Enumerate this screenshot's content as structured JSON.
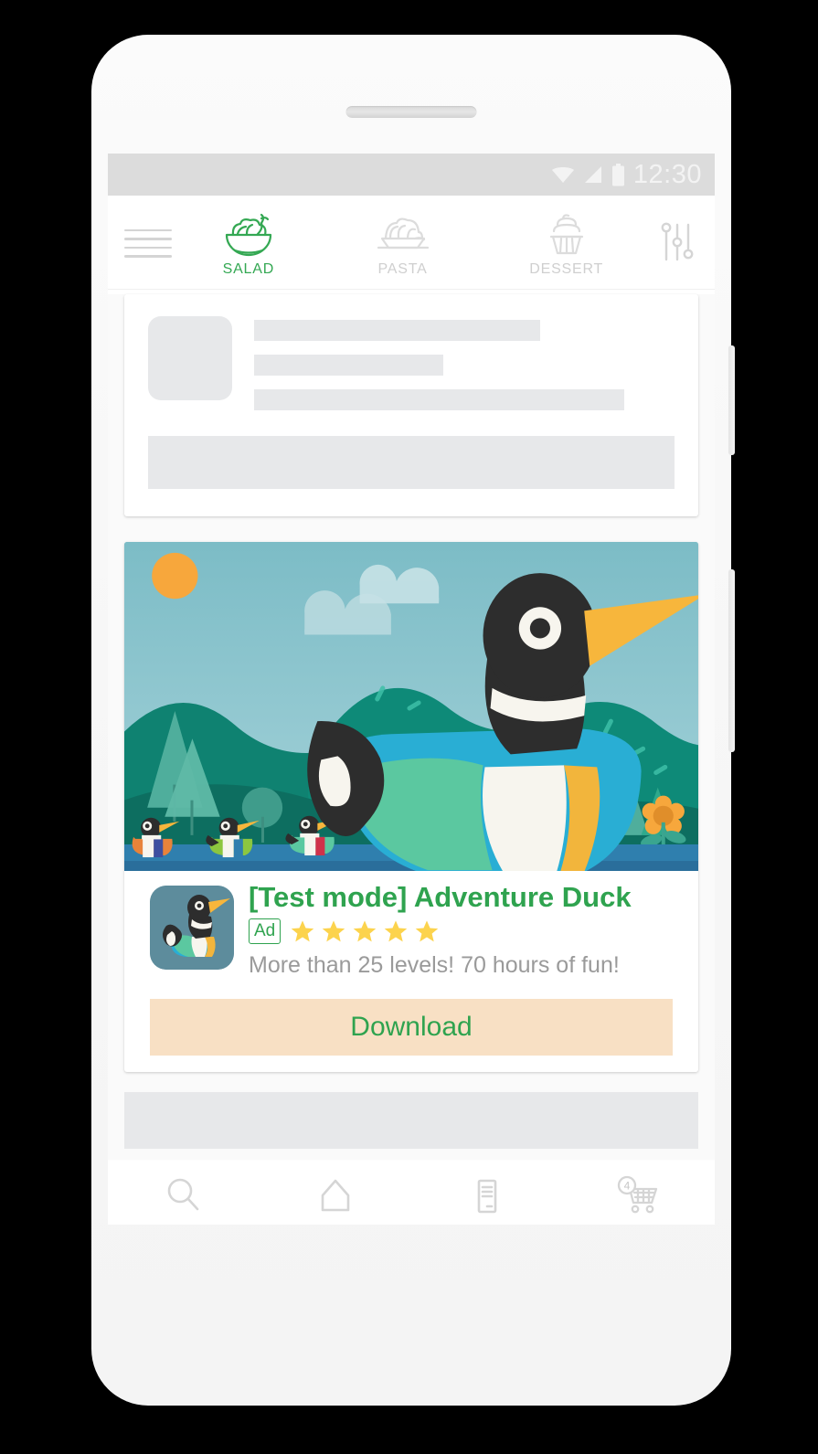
{
  "device": {
    "frame": "android-phone",
    "speaker_grille": "speaker-grille",
    "side_buttons": [
      "volume-button",
      "power-button"
    ]
  },
  "status_bar": {
    "time": "12:30",
    "icons": [
      "wifi-icon",
      "signal-icon",
      "battery-icon"
    ],
    "background": "#dcdcdc",
    "icon_color": "#f3f3f3"
  },
  "top_nav": {
    "menu_icon": "hamburger-menu-icon",
    "filter_icon": "tune-sliders-icon",
    "accent_color": "#34a853",
    "inactive_color": "#cfcfcf",
    "tabs": [
      {
        "label": "SALAD",
        "icon": "salad-bowl-icon",
        "active": true
      },
      {
        "label": "PASTA",
        "icon": "pasta-plate-icon",
        "active": false
      },
      {
        "label": "DESSERT",
        "icon": "cupcake-icon",
        "active": false
      }
    ]
  },
  "skeleton_card": {
    "thumbnail": "placeholder-thumbnail",
    "lines": 3,
    "block": "placeholder-block"
  },
  "ad": {
    "title": "[Test mode] Adventure Duck",
    "badge": "Ad",
    "rating": 5,
    "rating_max": 5,
    "description": "More than 25 levels! 70 hours of fun!",
    "cta_label": "Download",
    "title_color": "#2fa34f",
    "cta_background": "#f8e0c4",
    "cta_text_color": "#2fa34f",
    "star_color": "#fcd34d",
    "app_icon": "duck-app-icon",
    "hero_image": "duck-illustration",
    "illustration": {
      "sky": "#7fc0c9",
      "sun": "#f7a73c",
      "clouds": "#a7d2d8",
      "hills": "#0e8a78",
      "hills_dark": "#0d7a6b",
      "water": "#2f7fae",
      "duck_body": "#29aed4",
      "duck_head": "#2d2d2d",
      "duck_beak": "#f7b63c",
      "duck_wing": "#5bc8a0",
      "duck_belly": "#f7f5ee",
      "flower": "#f7a73c",
      "trees": "#4fae9c",
      "ducklings": 3
    }
  },
  "bottom_skeleton": {
    "name": "placeholder-bar"
  },
  "bottom_nav": {
    "items": [
      {
        "icon": "search-icon",
        "name": "search"
      },
      {
        "icon": "home-icon",
        "name": "home"
      },
      {
        "icon": "list-document-icon",
        "name": "orders"
      },
      {
        "icon": "shopping-cart-icon",
        "name": "cart",
        "badge": "4"
      }
    ],
    "icon_color": "#d5d5d5"
  }
}
